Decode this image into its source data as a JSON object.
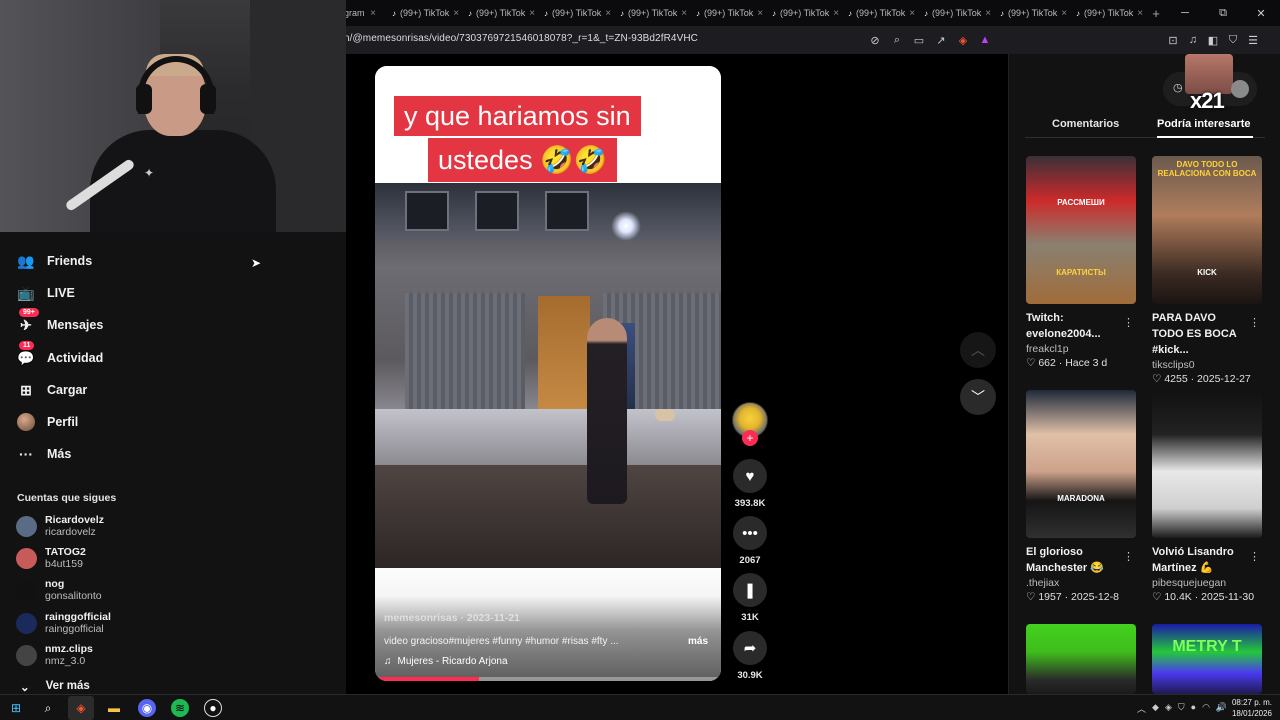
{
  "browser": {
    "tabs": [
      {
        "label": "gram"
      },
      {
        "label": "(99+) TikTok"
      },
      {
        "label": "(99+) TikTok"
      },
      {
        "label": "(99+) TikTok"
      },
      {
        "label": "(99+) TikTok"
      },
      {
        "label": "(99+) TikTok"
      },
      {
        "label": "(99+) TikTok"
      },
      {
        "label": "(99+) TikTok"
      },
      {
        "label": "(99+) TikTok"
      },
      {
        "label": "(99+) TikTok"
      },
      {
        "label": "(99+) TikTok"
      }
    ],
    "url": "n/@memesonrisas/video/7303769721546018078?_r=1&_t=ZN-93Bd2fR4VHC",
    "new_tab_icon": "plus-icon",
    "window_controls": {
      "minimize": "─",
      "restore": "⧉",
      "close": "✕"
    }
  },
  "sidebar": {
    "items": [
      {
        "label": "Friends",
        "icon": "friends-icon",
        "glyph": "👥"
      },
      {
        "label": "LIVE",
        "icon": "live-icon",
        "glyph": "📺"
      },
      {
        "label": "Mensajes",
        "icon": "messages-icon",
        "glyph": "✈",
        "badge": "99+"
      },
      {
        "label": "Actividad",
        "icon": "activity-icon",
        "glyph": "💬",
        "badge": "11"
      },
      {
        "label": "Cargar",
        "icon": "upload-icon",
        "glyph": "⊞"
      },
      {
        "label": "Perfil",
        "icon": "profile-avatar",
        "glyph": ""
      },
      {
        "label": "Más",
        "icon": "more-icon",
        "glyph": "···"
      }
    ],
    "following_title": "Cuentas que sigues",
    "following": [
      {
        "name": "Ricardovelz",
        "username": "ricardovelz",
        "color": "#5a6b86"
      },
      {
        "name": "TATOG2",
        "username": "b4ut159",
        "color": "#c85a5a"
      },
      {
        "name": "nog",
        "username": "gonsalitonto",
        "color": "#111111"
      },
      {
        "name": "rainggofficial",
        "username": "rainggofficial",
        "color": "#1a2a5a"
      },
      {
        "name": "nmz.clips",
        "username": "nmz_3.0",
        "color": "#444444"
      }
    ],
    "see_more": "Ver más"
  },
  "video": {
    "caption_line1": "y que hariamos sin",
    "caption_line2": "ustedes 🤣🤣",
    "author_line": "memesonrisas · 2023-11-21",
    "description": "video gracioso#mujeres #funny #humor #risas #fty ...",
    "more": "más",
    "music": "Mujeres - Ricardo Arjona",
    "music_icon": "♫",
    "progress": 0.3
  },
  "actions": {
    "like_count": "393.8K",
    "comment_count": "2067",
    "save_count": "31K",
    "share_count": "30.9K"
  },
  "right_panel": {
    "tab_comments": "Comentarios",
    "tab_suggested": "Podría interesarte",
    "pip_count": "x21",
    "cards": [
      {
        "title": "Twitch: evelone2004...",
        "user": "freakcl1p",
        "likes": "662",
        "date": "Hace 3 d",
        "label_top": "РАССМЕШИ",
        "label_bottom": "КАРАТИСТЫ"
      },
      {
        "title": "PARA DAVO TODO ES BOCA #kick...",
        "user": "tiksclips0",
        "likes": "4255",
        "date": "2025-12-27",
        "label_top": "DAVO TODO LO REALACIONA CON BOCA",
        "label_bottom": "KICK"
      },
      {
        "title": "El glorioso Manchester 😂",
        "user": ".thejiax",
        "likes": "1957",
        "date": "2025-12-8",
        "label_top": "",
        "label_bottom": "MARADONA"
      },
      {
        "title": "Volvió Lisandro Martínez 💪",
        "user": "pibesquejuegan",
        "likes": "10.4K",
        "date": "2025-11-30",
        "label_top": "",
        "label_bottom": ""
      },
      {
        "title": "",
        "user": "",
        "likes": "",
        "date": "",
        "label_top": "",
        "label_bottom": ""
      },
      {
        "title": "",
        "user": "",
        "likes": "",
        "date": "",
        "label_top": "METRY T",
        "label_bottom": ""
      }
    ]
  },
  "taskbar": {
    "time": "08:27 p. m.",
    "date": "18/01/2026"
  }
}
